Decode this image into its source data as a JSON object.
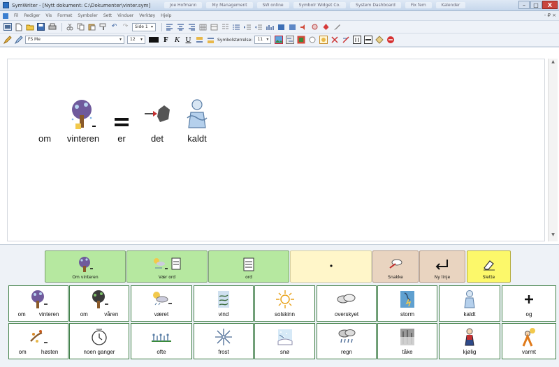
{
  "window": {
    "title": "SymWriter - [Nytt dokument: C:\\Dokumenter\\vinter.sym]",
    "taskbar_tabs": [
      "Joe Hofmann",
      "My Management",
      "SW online",
      "Symbolr Widget Co.",
      "System Dashboard",
      "Fix fem",
      "Kalender"
    ],
    "minimize": "–",
    "maximize": "□",
    "close": "X"
  },
  "menubar": {
    "items": [
      "Fil",
      "Rediger",
      "Vis",
      "Format",
      "Symboler",
      "Sett",
      "Vinduer",
      "Verktøy",
      "Hjelp"
    ],
    "right_controls": "- ₽ ×"
  },
  "toolbar1": {
    "page_combo": "Side 1"
  },
  "toolbar2": {
    "font_combo": "FS Me",
    "size_combo": "12",
    "bold": "F",
    "italic": "K",
    "underline": "U",
    "symbol_size_label": "Symbolstørrelse:",
    "symbol_size_value": "11"
  },
  "document": {
    "words": [
      {
        "label": "om",
        "icon": "none"
      },
      {
        "label": "vinteren",
        "icon": "winter-tree-icon"
      },
      {
        "label": "er",
        "icon": "equals-icon"
      },
      {
        "label": "det",
        "icon": "arrow-rock-icon"
      },
      {
        "label": "kaldt",
        "icon": "cold-person-icon"
      }
    ]
  },
  "topbar": {
    "cells": [
      {
        "label": "Om   vinteren",
        "icon": "winter-tree-icon",
        "color": "green"
      },
      {
        "label": "Vær      ord",
        "icon": "weather-word-icon",
        "color": "green"
      },
      {
        "label": "ord",
        "icon": "word-icon",
        "color": "green"
      },
      {
        "label": ".",
        "icon": "period-icon",
        "color": "yellow"
      },
      {
        "label": "Snakke",
        "icon": "speak-icon",
        "color": "tan"
      },
      {
        "label": "Ny linje",
        "icon": "new-line-icon",
        "color": "tan"
      },
      {
        "label": "Slette",
        "icon": "erase-icon",
        "color": "yellow2"
      }
    ]
  },
  "grid": {
    "row1": [
      {
        "left": "om",
        "right": "vinteren",
        "icon": "winter-tree-icon"
      },
      {
        "left": "om",
        "right": "våren",
        "icon": "spring-tree-icon"
      },
      {
        "label": "været",
        "icon": "weather-icon"
      },
      {
        "label": "vind",
        "icon": "wind-icon"
      },
      {
        "label": "solskinn",
        "icon": "sun-icon"
      },
      {
        "label": "overskyet",
        "icon": "cloud-icon"
      },
      {
        "label": "storm",
        "icon": "storm-icon"
      },
      {
        "label": "kaldt",
        "icon": "cold-person-icon"
      },
      {
        "label": "og",
        "icon": "plus-icon"
      }
    ],
    "row2": [
      {
        "left": "om",
        "right": "høsten",
        "icon": "autumn-tree-icon"
      },
      {
        "label": "noen ganger",
        "icon": "clock-icon"
      },
      {
        "label": "ofte",
        "icon": "often-icon"
      },
      {
        "label": "frost",
        "icon": "snowflake-icon"
      },
      {
        "label": "snø",
        "icon": "snow-icon"
      },
      {
        "label": "regn",
        "icon": "rain-icon"
      },
      {
        "label": "tåke",
        "icon": "fog-icon"
      },
      {
        "label": "kjølig",
        "icon": "cool-person-icon"
      },
      {
        "label": "varmt",
        "icon": "warm-person-icon"
      }
    ]
  },
  "colors": {
    "green": "#b6e8a0",
    "yellow": "#fff6c9",
    "tan": "#e9d4c0",
    "yellow2": "#fcf86a",
    "grid_border": "#3f7f45"
  }
}
